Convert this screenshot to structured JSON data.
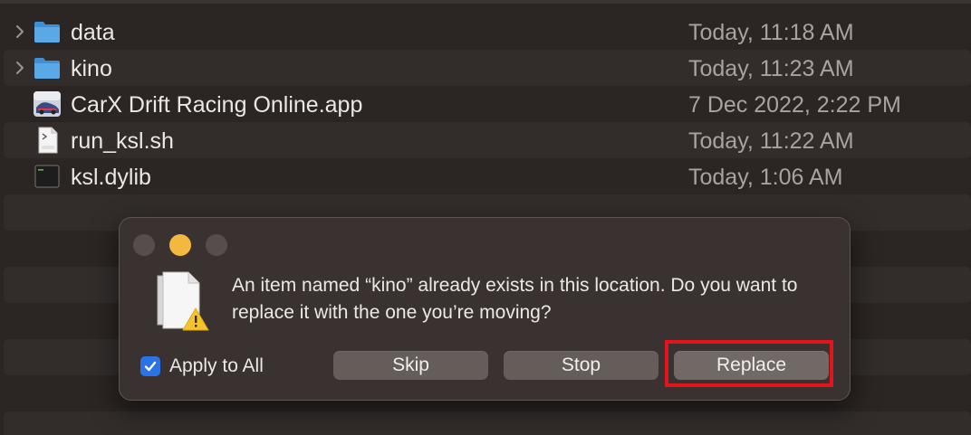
{
  "files": [
    {
      "name": "data",
      "date": "Today, 11:18 AM",
      "icon": "folder-icon",
      "expandable": true
    },
    {
      "name": "kino",
      "date": "Today, 11:23 AM",
      "icon": "folder-icon",
      "expandable": true
    },
    {
      "name": "CarX Drift Racing Online.app",
      "date": "7 Dec 2022, 2:22 PM",
      "icon": "app-icon",
      "expandable": false
    },
    {
      "name": "run_ksl.sh",
      "date": "Today, 11:22 AM",
      "icon": "shell-script-icon",
      "expandable": false
    },
    {
      "name": "ksl.dylib",
      "date": "Today, 1:06 AM",
      "icon": "terminal-exec-icon",
      "expandable": false
    }
  ],
  "dialog": {
    "message": "An item named “kino” already exists in this location. Do you want to replace it with the one you’re moving?",
    "apply_to_all": {
      "label": "Apply to All",
      "checked": true
    },
    "buttons": {
      "skip": "Skip",
      "stop": "Stop",
      "replace": "Replace"
    },
    "icon": "document-warning-icon"
  },
  "colors": {
    "background": "#2b2523",
    "dialog_bg": "#3a3230",
    "folder": "#5aa8e6",
    "checkbox": "#2b72e6",
    "highlight": "#e3141a",
    "traffic_yellow": "#f3b83f"
  }
}
